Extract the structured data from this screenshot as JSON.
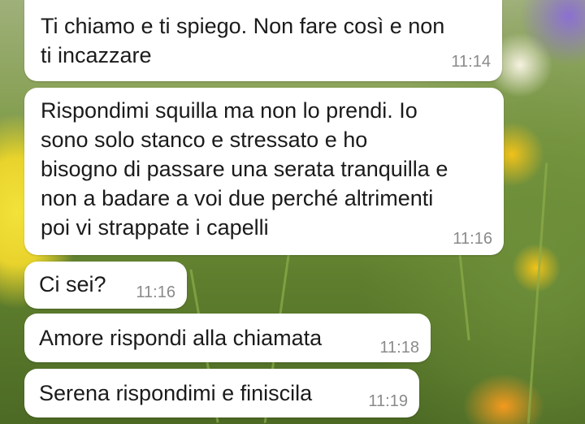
{
  "messages": [
    {
      "text": "Ti chiamo e ti spiego. Non fare così e non\nti incazzare",
      "time": "11:14"
    },
    {
      "text": "Rispondimi squilla ma non lo prendi. Io\nsono solo stanco e stressato e ho\nbisogno di passare una serata tranquilla e\nnon a badare a voi due perché altrimenti\npoi vi strappate i capelli",
      "time": "11:16"
    },
    {
      "text": "Ci sei?",
      "time": "11:16"
    },
    {
      "text": "Amore rispondi alla chiamata",
      "time": "11:18"
    },
    {
      "text": "Serena rispondimi e finiscila",
      "time": "11:19"
    }
  ],
  "colors": {
    "bubble": "#ffffff",
    "text": "#1b1b1b",
    "timestamp": "#8a8a8a"
  }
}
